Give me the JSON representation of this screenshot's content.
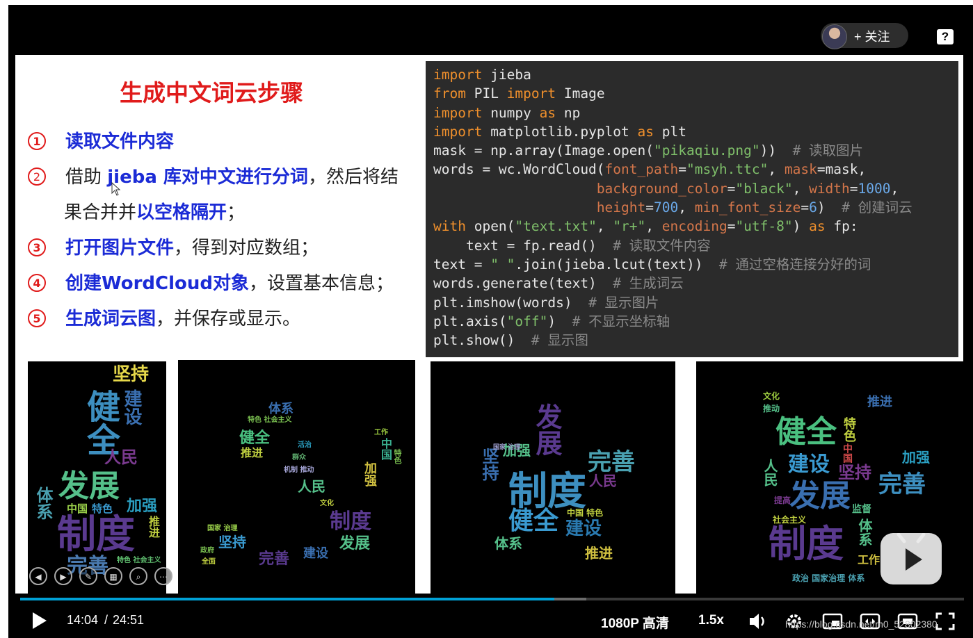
{
  "player": {
    "follow_label": "+ 关注",
    "help_label": "?",
    "current_time": "14:04",
    "separator": "/",
    "duration": "24:51",
    "progress_fraction": 0.566,
    "buffered_fraction": 0.6,
    "quality": "1080P 高清",
    "speed": "1.5x",
    "watermark": "https://blog.csdn.net/m0_52802380",
    "accent": "#00a1d6"
  },
  "slide": {
    "title": "生成中文词云步骤",
    "steps": [
      {
        "num": "1",
        "bold": "读取文件内容"
      },
      {
        "num": "2",
        "pre": "借助 ",
        "bold": "jieba 库对中文进行分词",
        "post": "，然后将结",
        "cont_pre": "果合并并",
        "cont_bold": "以空格隔开",
        "cont_post": "；"
      },
      {
        "num": "3",
        "bold": "打开图片文件",
        "post": "，得到对应数组；"
      },
      {
        "num": "4",
        "bold": "创建WordCloud对象",
        "post": "，设置基本信息；"
      },
      {
        "num": "5",
        "bold": "生成词云图",
        "post": "，并保存或显示。"
      }
    ]
  },
  "code": {
    "l1_kw": "import",
    "l1_rest": " jieba",
    "l2_kw1": "from",
    "l2_mid": " PIL ",
    "l2_kw2": "import",
    "l2_rest": " Image",
    "l3_kw1": "import",
    "l3_mid": " numpy ",
    "l3_kw2": "as",
    "l3_rest": " np",
    "l4_kw1": "import",
    "l4_mid": " matplotlib.pyplot ",
    "l4_kw2": "as",
    "l4_rest": " plt",
    "l5_a": "mask = np.array(Image.open(",
    "l5_str": "\"pikaqiu.png\"",
    "l5_b": "))  ",
    "l5_com": "# 读取图片",
    "l6_a": "words = wc.WordCloud(",
    "l6_arg1": "font_path",
    "l6_eq1": "=",
    "l6_str1": "\"msyh.ttc\"",
    "l6_c": ", ",
    "l6_arg2": "mask",
    "l6_d": "=mask,",
    "l7_pad": "                    ",
    "l7_arg1": "background_color",
    "l7_eq": "=",
    "l7_str": "\"black\"",
    "l7_c": ", ",
    "l7_arg2": "width",
    "l7_eq2": "=",
    "l7_num": "1000",
    "l7_d": ",",
    "l8_pad": "                    ",
    "l8_arg1": "height",
    "l8_eq": "=",
    "l8_num1": "700",
    "l8_c": ", ",
    "l8_arg2": "min_font_size",
    "l8_eq2": "=",
    "l8_num2": "6",
    "l8_d": ")  ",
    "l8_com": "# 创建词云",
    "l9_kw1": "with",
    "l9_a": " open(",
    "l9_str1": "\"text.txt\"",
    "l9_b": ", ",
    "l9_str2": "\"r+\"",
    "l9_c": ", ",
    "l9_arg": "encoding",
    "l9_eq": "=",
    "l9_str3": "\"utf-8\"",
    "l9_d": ") ",
    "l9_kw2": "as",
    "l9_e": " fp:",
    "l10_a": "    text = fp.read()  ",
    "l10_com": "# 读取文件内容",
    "l11_a": "text = ",
    "l11_str": "\" \"",
    "l11_b": ".join(jieba.lcut(text))  ",
    "l11_com": "# 通过空格连接分好的词",
    "l12_a": "words.generate(text)  ",
    "l12_com": "# 生成词云",
    "l13_a": "plt.imshow(words)  ",
    "l13_com": "# 显示图片",
    "l14_a": "plt.axis(",
    "l14_str": "\"off\"",
    "l14_b": ")  ",
    "l14_com": "# 不显示坐标轴",
    "l15_a": "plt.show()  ",
    "l15_com": "# 显示图"
  },
  "clouds": {
    "c1": [
      "坚持",
      "建设",
      "健全",
      "人民",
      "发展",
      "中国",
      "特色",
      "加强",
      "体系",
      "制度",
      "完善",
      "推进",
      "社会主义",
      "特色 社会主义"
    ],
    "c2": [
      "体系",
      "特色 社会主义",
      "健全",
      "推进",
      "活治",
      "群众",
      "人民",
      "机制 推动",
      "加强",
      "中国",
      "特色",
      "工作",
      "文化",
      "制度",
      "坚持",
      "发展",
      "建设",
      "完善",
      "国家 治理",
      "全面",
      "政府"
    ],
    "c3": [
      "发展",
      "加强",
      "坚持",
      "完善",
      "制度",
      "人民",
      "健全",
      "建设",
      "体系",
      "推进",
      "中国 特色",
      "国家 治理"
    ],
    "c4": [
      "健全",
      "特色",
      "中国",
      "推进",
      "人民",
      "建设",
      "加强",
      "坚持",
      "完善",
      "发展",
      "监督",
      "制度",
      "体系",
      "社会主义",
      "工作",
      "政治 国家治理 体系",
      "推动",
      "文化",
      "提高"
    ]
  }
}
